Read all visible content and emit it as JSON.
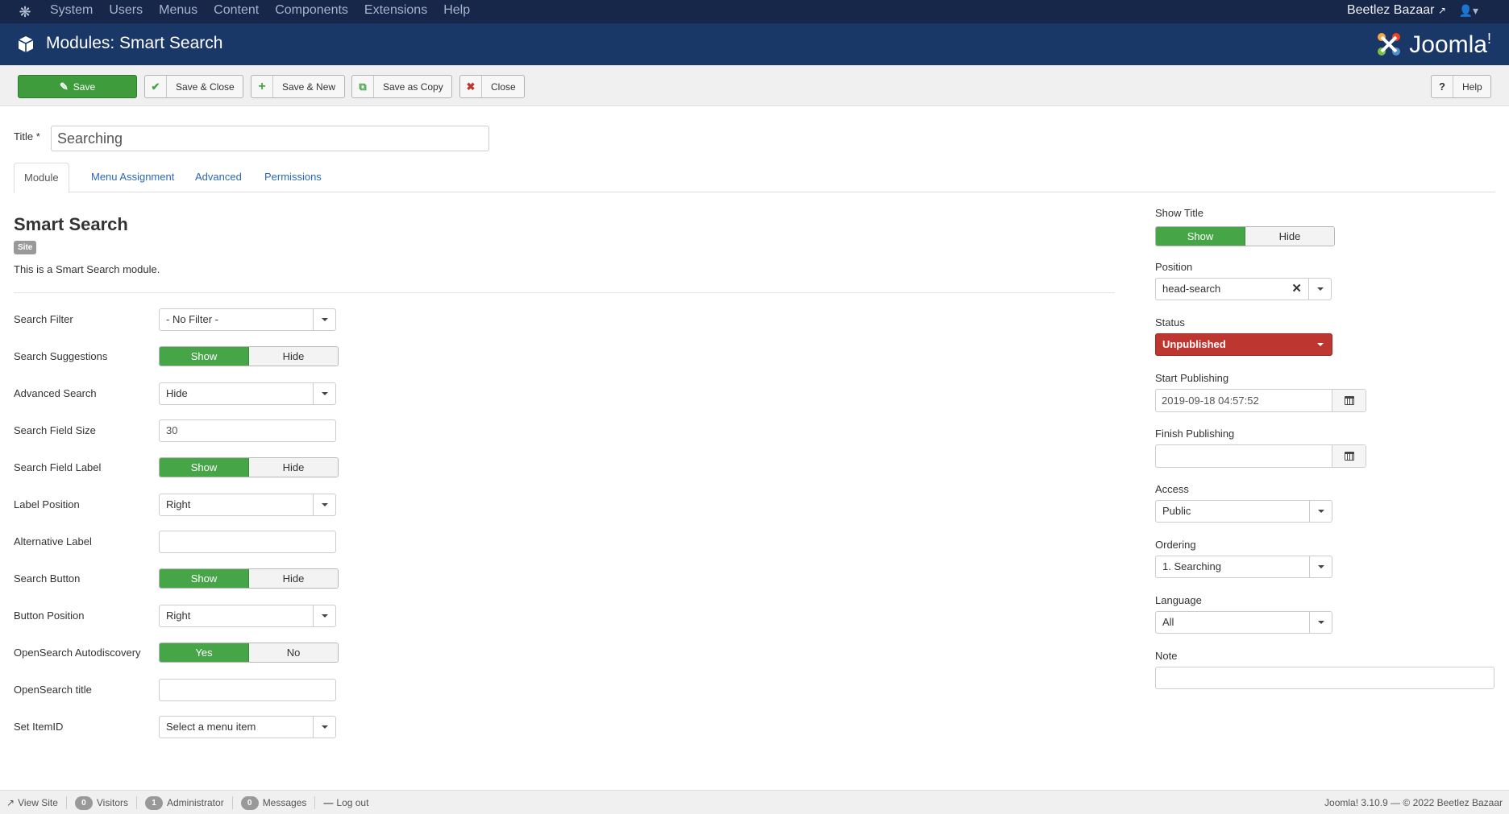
{
  "topnav": {
    "menu": [
      "System",
      "Users",
      "Menus",
      "Content",
      "Components",
      "Extensions",
      "Help"
    ],
    "site_name": "Beetlez Bazaar",
    "user_icon": "user-icon"
  },
  "header": {
    "title": "Modules: Smart Search",
    "brand": "Joomla!",
    "brand_word": "Joomla",
    "brand_mark": "!"
  },
  "toolbar": {
    "save": "Save",
    "save_close": "Save & Close",
    "save_new": "Save & New",
    "save_copy": "Save as Copy",
    "close": "Close",
    "help": "Help"
  },
  "title_field": {
    "label": "Title *",
    "value": "Searching"
  },
  "tabs": [
    "Module",
    "Menu Assignment",
    "Advanced",
    "Permissions"
  ],
  "module": {
    "name": "Smart Search",
    "badge": "Site",
    "description": "This is a Smart Search module."
  },
  "fields": {
    "search_filter": {
      "label": "Search Filter",
      "value": "- No Filter -"
    },
    "search_suggestions": {
      "label": "Search Suggestions",
      "on": "Show",
      "off": "Hide"
    },
    "advanced_search": {
      "label": "Advanced Search",
      "value": "Hide"
    },
    "search_field_size": {
      "label": "Search Field Size",
      "value": "30"
    },
    "search_field_label": {
      "label": "Search Field Label",
      "on": "Show",
      "off": "Hide"
    },
    "label_position": {
      "label": "Label Position",
      "value": "Right"
    },
    "alternative_label": {
      "label": "Alternative Label",
      "value": ""
    },
    "search_button": {
      "label": "Search Button",
      "on": "Show",
      "off": "Hide"
    },
    "button_position": {
      "label": "Button Position",
      "value": "Right"
    },
    "opensearch_autodiscovery": {
      "label": "OpenSearch Autodiscovery",
      "on": "Yes",
      "off": "No"
    },
    "opensearch_title": {
      "label": "OpenSearch title",
      "value": ""
    },
    "set_itemid": {
      "label": "Set ItemID",
      "value": "Select a menu item"
    }
  },
  "sidebar": {
    "show_title": {
      "label": "Show Title",
      "on": "Show",
      "off": "Hide"
    },
    "position": {
      "label": "Position",
      "value": "head-search"
    },
    "status": {
      "label": "Status",
      "value": "Unpublished"
    },
    "start_publishing": {
      "label": "Start Publishing",
      "value": "2019-09-18 04:57:52"
    },
    "finish_publishing": {
      "label": "Finish Publishing",
      "value": ""
    },
    "access": {
      "label": "Access",
      "value": "Public"
    },
    "ordering": {
      "label": "Ordering",
      "value": "1. Searching"
    },
    "language": {
      "label": "Language",
      "value": "All"
    },
    "note": {
      "label": "Note",
      "value": ""
    }
  },
  "footer": {
    "view_site": "View Site",
    "visitors_count": "0",
    "visitors": "Visitors",
    "admin_count": "1",
    "administrator": "Administrator",
    "messages_count": "0",
    "messages": "Messages",
    "logout": "Log out",
    "copyright": "Joomla! 3.10.9 — © 2022 Beetlez Bazaar"
  },
  "colors": {
    "topnav_bg": "#17274a",
    "header_bg": "#1a3867",
    "save_green": "#3f9c3c",
    "toggle_green": "#46a546",
    "status_red": "#bd362f",
    "link_blue": "#2a69b8"
  }
}
